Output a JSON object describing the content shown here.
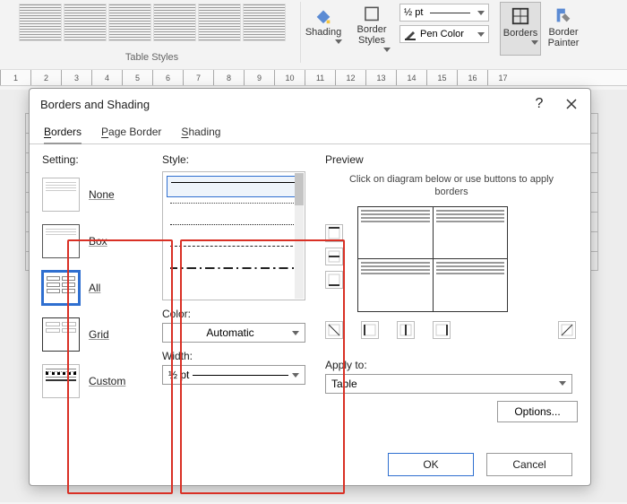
{
  "ribbon": {
    "group_tablestyles": "Table Styles",
    "group_borders": "Borders",
    "shading": "Shading",
    "border_styles": "Border Styles",
    "borders_btn": "Borders",
    "border_painter": "Border Painter",
    "weight": "½ pt",
    "pen_color": "Pen Color"
  },
  "ruler_marks": [
    "1",
    "2",
    "3",
    "4",
    "5",
    "6",
    "7",
    "8",
    "9",
    "10",
    "11",
    "12",
    "13",
    "14",
    "15",
    "16",
    "17"
  ],
  "dialog": {
    "title": "Borders and Shading",
    "help": "?",
    "tabs": {
      "borders": "Borders",
      "page_border": "Page Border",
      "shading": "Shading"
    },
    "setting_label": "Setting:",
    "settings": {
      "none": "None",
      "box": "Box",
      "all": "All",
      "grid": "Grid",
      "custom": "Custom"
    },
    "style_label": "Style:",
    "color_label": "Color:",
    "color_value": "Automatic",
    "width_label": "Width:",
    "width_value": "½ pt",
    "preview_label": "Preview",
    "preview_hint": "Click on diagram below or use buttons to apply borders",
    "apply_label": "Apply to:",
    "apply_value": "Table",
    "options_btn": "Options...",
    "ok": "OK",
    "cancel": "Cancel"
  }
}
